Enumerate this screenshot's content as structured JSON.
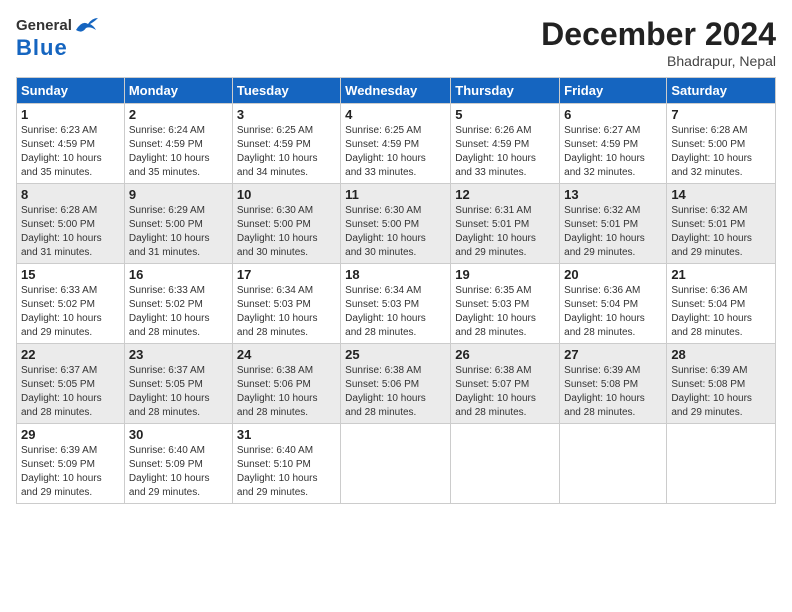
{
  "logo": {
    "general": "General",
    "blue": "Blue"
  },
  "title": "December 2024",
  "subtitle": "Bhadrapur, Nepal",
  "days_of_week": [
    "Sunday",
    "Monday",
    "Tuesday",
    "Wednesday",
    "Thursday",
    "Friday",
    "Saturday"
  ],
  "weeks": [
    [
      {
        "day": "1",
        "info": "Sunrise: 6:23 AM\nSunset: 4:59 PM\nDaylight: 10 hours\nand 35 minutes."
      },
      {
        "day": "2",
        "info": "Sunrise: 6:24 AM\nSunset: 4:59 PM\nDaylight: 10 hours\nand 35 minutes."
      },
      {
        "day": "3",
        "info": "Sunrise: 6:25 AM\nSunset: 4:59 PM\nDaylight: 10 hours\nand 34 minutes."
      },
      {
        "day": "4",
        "info": "Sunrise: 6:25 AM\nSunset: 4:59 PM\nDaylight: 10 hours\nand 33 minutes."
      },
      {
        "day": "5",
        "info": "Sunrise: 6:26 AM\nSunset: 4:59 PM\nDaylight: 10 hours\nand 33 minutes."
      },
      {
        "day": "6",
        "info": "Sunrise: 6:27 AM\nSunset: 4:59 PM\nDaylight: 10 hours\nand 32 minutes."
      },
      {
        "day": "7",
        "info": "Sunrise: 6:28 AM\nSunset: 5:00 PM\nDaylight: 10 hours\nand 32 minutes."
      }
    ],
    [
      {
        "day": "8",
        "info": "Sunrise: 6:28 AM\nSunset: 5:00 PM\nDaylight: 10 hours\nand 31 minutes."
      },
      {
        "day": "9",
        "info": "Sunrise: 6:29 AM\nSunset: 5:00 PM\nDaylight: 10 hours\nand 31 minutes."
      },
      {
        "day": "10",
        "info": "Sunrise: 6:30 AM\nSunset: 5:00 PM\nDaylight: 10 hours\nand 30 minutes."
      },
      {
        "day": "11",
        "info": "Sunrise: 6:30 AM\nSunset: 5:00 PM\nDaylight: 10 hours\nand 30 minutes."
      },
      {
        "day": "12",
        "info": "Sunrise: 6:31 AM\nSunset: 5:01 PM\nDaylight: 10 hours\nand 29 minutes."
      },
      {
        "day": "13",
        "info": "Sunrise: 6:32 AM\nSunset: 5:01 PM\nDaylight: 10 hours\nand 29 minutes."
      },
      {
        "day": "14",
        "info": "Sunrise: 6:32 AM\nSunset: 5:01 PM\nDaylight: 10 hours\nand 29 minutes."
      }
    ],
    [
      {
        "day": "15",
        "info": "Sunrise: 6:33 AM\nSunset: 5:02 PM\nDaylight: 10 hours\nand 29 minutes."
      },
      {
        "day": "16",
        "info": "Sunrise: 6:33 AM\nSunset: 5:02 PM\nDaylight: 10 hours\nand 28 minutes."
      },
      {
        "day": "17",
        "info": "Sunrise: 6:34 AM\nSunset: 5:03 PM\nDaylight: 10 hours\nand 28 minutes."
      },
      {
        "day": "18",
        "info": "Sunrise: 6:34 AM\nSunset: 5:03 PM\nDaylight: 10 hours\nand 28 minutes."
      },
      {
        "day": "19",
        "info": "Sunrise: 6:35 AM\nSunset: 5:03 PM\nDaylight: 10 hours\nand 28 minutes."
      },
      {
        "day": "20",
        "info": "Sunrise: 6:36 AM\nSunset: 5:04 PM\nDaylight: 10 hours\nand 28 minutes."
      },
      {
        "day": "21",
        "info": "Sunrise: 6:36 AM\nSunset: 5:04 PM\nDaylight: 10 hours\nand 28 minutes."
      }
    ],
    [
      {
        "day": "22",
        "info": "Sunrise: 6:37 AM\nSunset: 5:05 PM\nDaylight: 10 hours\nand 28 minutes."
      },
      {
        "day": "23",
        "info": "Sunrise: 6:37 AM\nSunset: 5:05 PM\nDaylight: 10 hours\nand 28 minutes."
      },
      {
        "day": "24",
        "info": "Sunrise: 6:38 AM\nSunset: 5:06 PM\nDaylight: 10 hours\nand 28 minutes."
      },
      {
        "day": "25",
        "info": "Sunrise: 6:38 AM\nSunset: 5:06 PM\nDaylight: 10 hours\nand 28 minutes."
      },
      {
        "day": "26",
        "info": "Sunrise: 6:38 AM\nSunset: 5:07 PM\nDaylight: 10 hours\nand 28 minutes."
      },
      {
        "day": "27",
        "info": "Sunrise: 6:39 AM\nSunset: 5:08 PM\nDaylight: 10 hours\nand 28 minutes."
      },
      {
        "day": "28",
        "info": "Sunrise: 6:39 AM\nSunset: 5:08 PM\nDaylight: 10 hours\nand 29 minutes."
      }
    ],
    [
      {
        "day": "29",
        "info": "Sunrise: 6:39 AM\nSunset: 5:09 PM\nDaylight: 10 hours\nand 29 minutes."
      },
      {
        "day": "30",
        "info": "Sunrise: 6:40 AM\nSunset: 5:09 PM\nDaylight: 10 hours\nand 29 minutes."
      },
      {
        "day": "31",
        "info": "Sunrise: 6:40 AM\nSunset: 5:10 PM\nDaylight: 10 hours\nand 29 minutes."
      },
      {
        "day": "",
        "info": ""
      },
      {
        "day": "",
        "info": ""
      },
      {
        "day": "",
        "info": ""
      },
      {
        "day": "",
        "info": ""
      }
    ]
  ]
}
